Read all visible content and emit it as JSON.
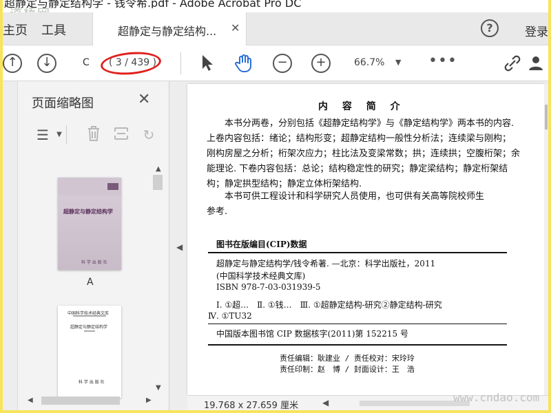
{
  "window": {
    "title": "超静定与静定结构学 - 钱令希.pdf - Adobe Acrobat Pro DC",
    "watermark": "道桥网"
  },
  "tabs": {
    "home": "主页",
    "tools": "工具",
    "document": "超静定与静定结构...",
    "document_close": "✕",
    "help": "?",
    "login": "登录"
  },
  "toolbar": {
    "prev_icon": "arrow-up-circle-icon",
    "next_icon": "arrow-down-circle-icon",
    "page_input": "C",
    "page_count": "( 3 / 439 )",
    "zoom": "66.7%",
    "more": "•••",
    "annotation_color": "#e0201c"
  },
  "thumbnails": {
    "title": "页面缩略图",
    "close": "✕",
    "pages": [
      {
        "label": "A",
        "cover_title": "超静定与静定结构学",
        "cover_foot": "科 学 出 版 社"
      },
      {
        "label": "",
        "header": "中国科学技术经典文库",
        "title": "超静定与静定结构学",
        "foot": "科 学 出 版 社"
      }
    ]
  },
  "document": {
    "heading": "内 容 简 介",
    "paragraph1": [
      "本书分两卷，分别包括《超静定结构学》与《静定结构学》两本书的内容.",
      "上卷内容包括：绪论；结构形变；超静定结构一般性分析法；连续梁与刚构；",
      "刚构房屋之分析；桁架次应力；柱比法及变梁常数；拱；连续拱；空腹桁架；余",
      "能理论. 下卷内容包括：总论；结构稳定性的研究；静定梁结构；静定桁架结",
      "构；静定拱型结构；静定立体桁架结构."
    ],
    "paragraph2": [
      "本书可供工程设计和科学研究人员使用，也可供有关高等院校师生",
      "参考."
    ],
    "cip_title": "图书在版编目(CIP)数据",
    "cip_lines": [
      "超静定与静定结构学/钱令希著. —北京：科学出版社，2011",
      "(中国科学技术经典文库)",
      "ISBN 978-7-03-031939-5",
      "Ⅰ. ①超…　Ⅱ. ①钱…　Ⅲ. ①超静定结构-研究②静定结构-研究",
      "Ⅳ. ①TU32"
    ],
    "cip_number": "中国版本图书馆 CIP 数据核字(2011)第 152215 号",
    "credits": [
      "责任编辑：耿建业 / 责任校对：宋玲玲",
      "责任印制：赵　博 / 封面设计：王　浩"
    ]
  },
  "status": {
    "dimensions": "19.768 x 27.659 厘米",
    "watermark": "www.cndao.com"
  }
}
